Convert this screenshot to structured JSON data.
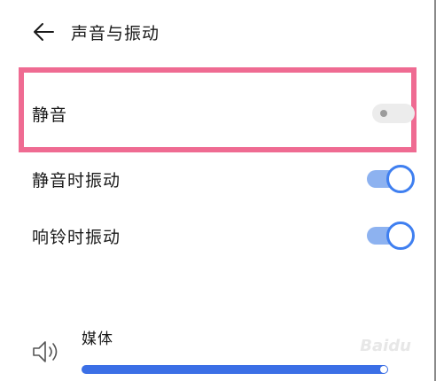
{
  "header": {
    "title": "声音与振动",
    "back_icon": "arrow-left-icon"
  },
  "settings": [
    {
      "label": "静音",
      "state": "off"
    },
    {
      "label": "静音时振动",
      "state": "on"
    },
    {
      "label": "响铃时振动",
      "state": "on"
    }
  ],
  "media": {
    "label": "媒体",
    "icon": "speaker-icon",
    "volume_fraction": 1.0
  },
  "colors": {
    "highlight_border": "#ef6b92",
    "accent": "#3f7ff0",
    "track_on": "#8db2f0",
    "slider_fill": "#3b6fe6"
  },
  "watermark": "Baidu"
}
